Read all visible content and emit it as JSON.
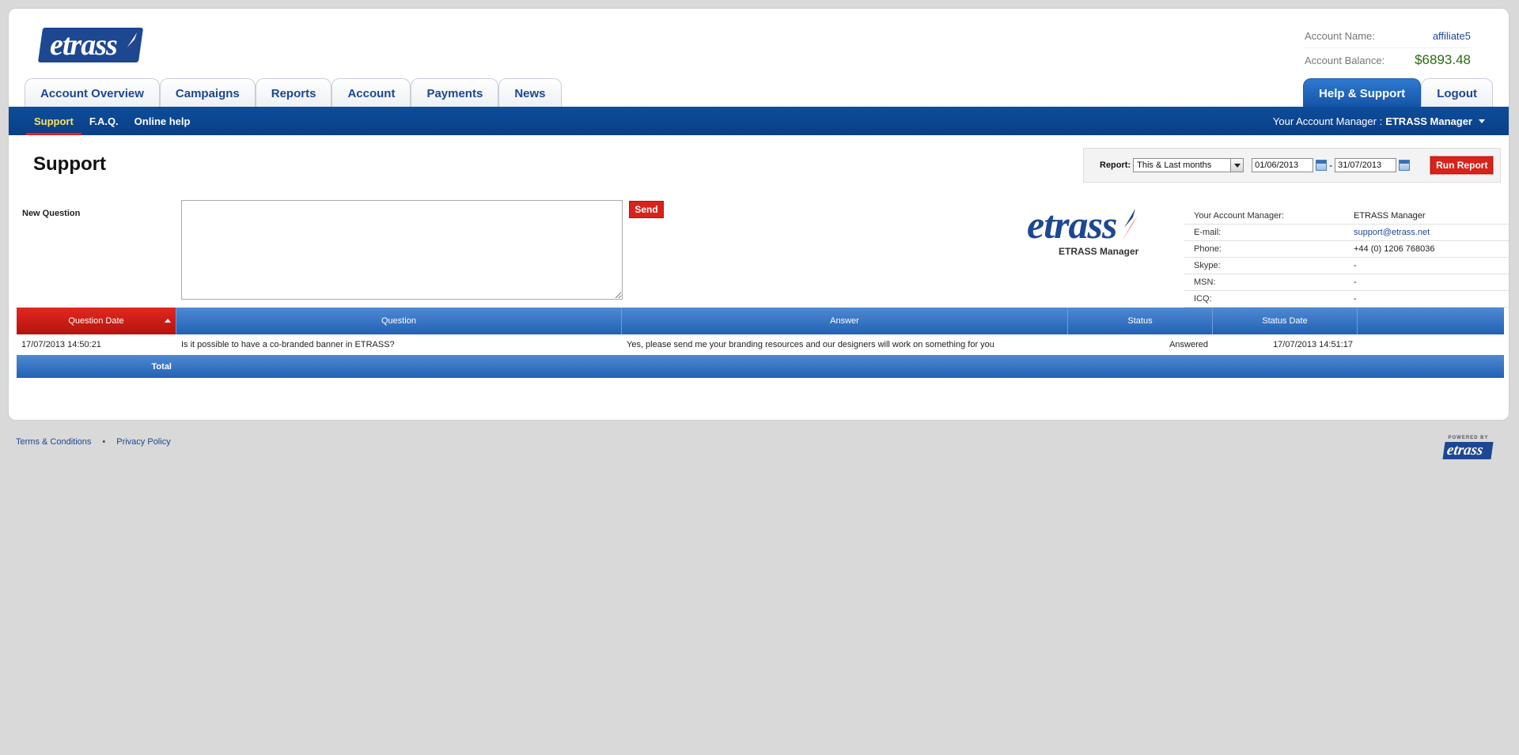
{
  "brand": {
    "logo_text": "etrass",
    "powered_by": "POWERED BY",
    "primary": "#1d4791",
    "accent": "#d8231a"
  },
  "account": {
    "name_label": "Account Name:",
    "name_value": "affiliate5",
    "balance_label": "Account Balance:",
    "balance_value": "$6893.48"
  },
  "tabs_left": [
    {
      "label": "Account Overview"
    },
    {
      "label": "Campaigns"
    },
    {
      "label": "Reports"
    },
    {
      "label": "Account"
    },
    {
      "label": "Payments"
    },
    {
      "label": "News"
    }
  ],
  "tabs_right": [
    {
      "label": "Help & Support",
      "active": true
    },
    {
      "label": "Logout"
    }
  ],
  "subnav": {
    "items": [
      {
        "label": "Support",
        "active": true
      },
      {
        "label": "F.A.Q."
      },
      {
        "label": "Online help"
      }
    ],
    "manager_prefix": "Your Account Manager :",
    "manager_name": "ETRASS Manager"
  },
  "page": {
    "title": "Support"
  },
  "report": {
    "label": "Report:",
    "range_option": "This & Last months",
    "date_from": "01/06/2013",
    "date_sep": "-",
    "date_to": "31/07/2013",
    "run_label": "Run Report"
  },
  "new_question": {
    "label": "New Question",
    "value": "",
    "send_label": "Send"
  },
  "manager_card": {
    "logo_text": "etrass",
    "caption": "ETRASS Manager",
    "rows": [
      {
        "k": "Your Account Manager:",
        "v": "ETRASS Manager"
      },
      {
        "k": "E-mail:",
        "v": "support@etrass.net"
      },
      {
        "k": "Phone:",
        "v": "+44 (0) 1206 768036"
      },
      {
        "k": "Skype:",
        "v": "-"
      },
      {
        "k": "MSN:",
        "v": "-"
      },
      {
        "k": "ICQ:",
        "v": "-"
      }
    ]
  },
  "table": {
    "columns": [
      "Question Date",
      "Question",
      "Answer",
      "Status",
      "Status Date",
      ""
    ],
    "rows": [
      {
        "date": "17/07/2013 14:50:21",
        "question": "Is it possible to have a co-branded banner in ETRASS?",
        "answer": "Yes, please send me your branding resources and our designers will work on something for you",
        "status": "Answered",
        "status_date": "17/07/2013 14:51:17"
      }
    ],
    "total_label": "Total"
  },
  "footer": {
    "terms": "Terms & Conditions",
    "bullet": "•",
    "privacy": "Privacy Policy"
  }
}
